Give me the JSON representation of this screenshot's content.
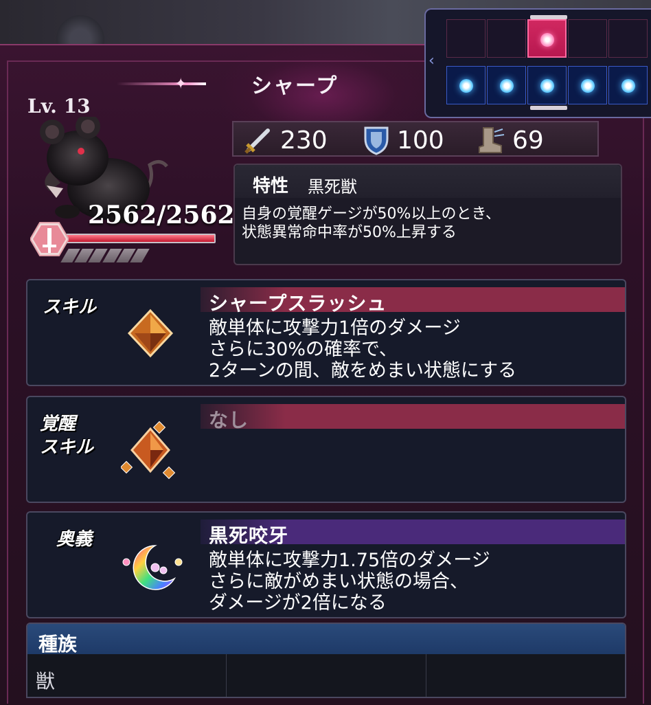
{
  "unit": {
    "name": "シャープ",
    "level": "Lv. 13",
    "hp": "2562/2562",
    "hp_ratio": 1.0
  },
  "stats": {
    "attack": "230",
    "defense": "100",
    "speed": "69",
    "attack_icon": "sword-icon",
    "defense_icon": "shield-icon",
    "speed_icon": "boot-icon"
  },
  "formation": {
    "back_row_active_index": 2,
    "front_row_count": 5
  },
  "trait": {
    "label": "特性",
    "name": "黒死獣",
    "description": "自身の覚醒ゲージが50%以上のとき、\n状態異常命中率が50%上昇する"
  },
  "skill": {
    "category": "スキル",
    "name": "シャープスラッシュ",
    "description": "敵単体に攻撃力1倍のダメージ\nさらに30%の確率で、\n2ターンの間、敵をめまい状態にする"
  },
  "awakened_skill": {
    "category": "覚醒\n スキル",
    "name": "なし"
  },
  "ultimate": {
    "category": "奥義",
    "name": "黒死咬牙",
    "description": "敵単体に攻撃力1.75倍のダメージ\nさらに敵がめまい状態の場合、\nダメージが2倍になる"
  },
  "race": {
    "title": "種族",
    "values": [
      "獣",
      "",
      ""
    ]
  },
  "colors": {
    "skill_header": "#8a2c48",
    "ultimate_header": "#4a2a7a",
    "race_header": "#1e3a68",
    "hp_fill": "#c41830",
    "formation_active": "#d02860",
    "formation_front": "#1a7ae8"
  }
}
